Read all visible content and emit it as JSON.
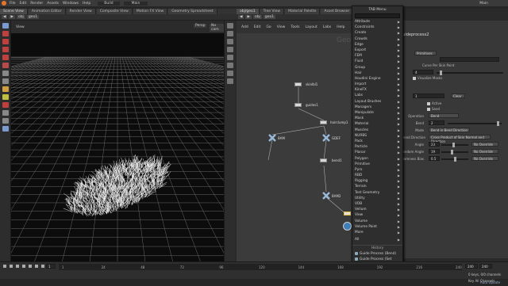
{
  "menubar": {
    "items": [
      "File",
      "Edit",
      "Render",
      "Assets",
      "Windows",
      "Help"
    ],
    "build_label": "Build",
    "desktop_label": "Main",
    "right_label": "Main"
  },
  "left_tabs": [
    "Scene View",
    "Animation Editor",
    "Render View",
    "Composite View",
    "Motion FX View",
    "Geometry Spreadsheet"
  ],
  "mid_tabs": [
    "obj/geo1",
    "Tree View",
    "Material Palette",
    "Asset Browser"
  ],
  "path": {
    "obj": "obj",
    "geo": "geo1"
  },
  "viewport": {
    "label": "View",
    "persp": "Persp",
    "cam": "No cam",
    "hint": "Left mouse tumbles. Middle pans. Right dollies. Ctrl+Alt+Left box-zooms. Ctrl+Right zooms. Spacebar-Ctrl-Left tilts. Hold L for alternate tumble, dolly, and zoom.    M or Alt+M for First Person Navigation."
  },
  "network": {
    "menu": [
      "Add",
      "Edit",
      "Go",
      "View",
      "Tools",
      "Layout",
      "Labs",
      "Help"
    ],
    "watermark": "Geo",
    "nodes": {
      "n1": "skinlbl1",
      "n2": "guides1",
      "n3": "hairclump1",
      "n4": "BAM",
      "n5": "GDEF",
      "n6": "bend1",
      "n7": "BAM2",
      "n8": "guideprocess2"
    }
  },
  "params": {
    "title": "guideprocess2",
    "group_type": "Primitives",
    "curve_label": "Curve Per Skin Point",
    "count_val": "4",
    "visualize": "Visualize Masks",
    "use_val": "1",
    "clear": "Clear",
    "active": "Active",
    "seed": "Seed",
    "operation_label": "Operation",
    "operation_val": "Bend",
    "bend_label": "Bend",
    "bend_val": "2",
    "mode_label": "Mode",
    "mode_val": "Bend in Bend Direction",
    "dir_label": "Bend Direction",
    "dir_val": "Cross Product of Skin Normal and Direction",
    "angle_label": "Angle",
    "angle_val": "23",
    "random_label": "Random Angle",
    "random_val": "19",
    "rand_label": "Randomness Bias",
    "rand_val": "0.5",
    "override": "No Override",
    "frames_label": "0 keys, 0/0 channels",
    "channels_label": "Key All Channels",
    "auto_label": "Auto Update"
  },
  "tab_menu": {
    "title": "TAB Menu",
    "items": [
      "Attribute",
      "Constraints",
      "Create",
      "Crowds",
      "Edge",
      "Export",
      "FEM",
      "Fluid",
      "Group",
      "Hair",
      "Houdini Engine",
      "Import",
      "KineFX",
      "Labs",
      "Layout Brushes",
      "Managers",
      "Manipulate",
      "Mask",
      "Material",
      "Muscles",
      "NURBS",
      "Pack",
      "Particle",
      "Planar",
      "Polygon",
      "Primitive",
      "Pyro",
      "RBD",
      "Rigging",
      "Terrain",
      "Test Geometry",
      "Utility",
      "VDB",
      "Vellum",
      "View",
      "Volume",
      "Volume Paint",
      "More"
    ],
    "all_label": "All",
    "history_label": "History",
    "history": [
      "Guide Process (Bend)",
      "Guide Process (Set Length)",
      "Null",
      "Guide Skin Attribute Lookup",
      "Hair Generate",
      "Rest Position"
    ]
  },
  "timeline": {
    "frame": "1",
    "ticks": [
      "1",
      "24",
      "48",
      "72",
      "96",
      "120",
      "144",
      "168",
      "192",
      "216",
      "240"
    ],
    "end": "240",
    "end2": "240"
  },
  "colors": {
    "accent": "#e8742a",
    "viewport_bg": "#0c0c0c",
    "network_bg": "#3b3b3b"
  }
}
